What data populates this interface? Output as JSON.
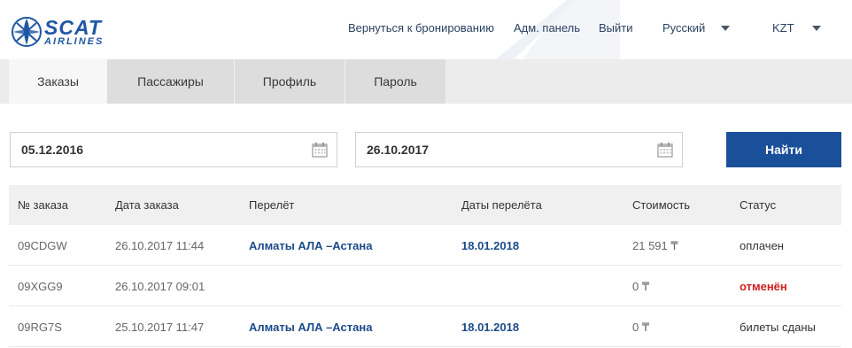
{
  "header": {
    "logo": {
      "main": "SCAT",
      "sub": "AIRLINES"
    },
    "links": [
      "Вернуться к бронированию",
      "Адм. панель",
      "Выйти"
    ],
    "language": "Русский",
    "currency": "KZT"
  },
  "tabs": [
    "Заказы",
    "Пассажиры",
    "Профиль",
    "Пароль"
  ],
  "filters": {
    "date_from": "05.12.2016",
    "date_to": "26.10.2017",
    "search_label": "Найти"
  },
  "table": {
    "columns": [
      "№ заказа",
      "Дата заказа",
      "Перелёт",
      "Даты перелёта",
      "Стоимость",
      "Статус"
    ],
    "rows": [
      {
        "order": "09CDGW",
        "order_date": "26.10.2017 11:44",
        "route": "Алматы АЛА –Астана",
        "flight_date": "18.01.2018",
        "cost": "21 591 ₸",
        "status": "оплачен"
      },
      {
        "order": "09XGG9",
        "order_date": "26.10.2017 09:01",
        "route": "",
        "flight_date": "",
        "cost": "0 ₸",
        "status": "отменён"
      },
      {
        "order": "09RG7S",
        "order_date": "25.10.2017 11:47",
        "route": "Алматы АЛА –Астана",
        "flight_date": "18.01.2018",
        "cost": "0 ₸",
        "status": "билеты сданы"
      }
    ]
  },
  "colors": {
    "brand": "#1f57a5",
    "button": "#1a4f99",
    "link": "#1b4a8a",
    "status_cancelled": "#d0201f"
  },
  "icons": [
    "logo-mark",
    "calendar-icon",
    "chevron-down-icon"
  ]
}
